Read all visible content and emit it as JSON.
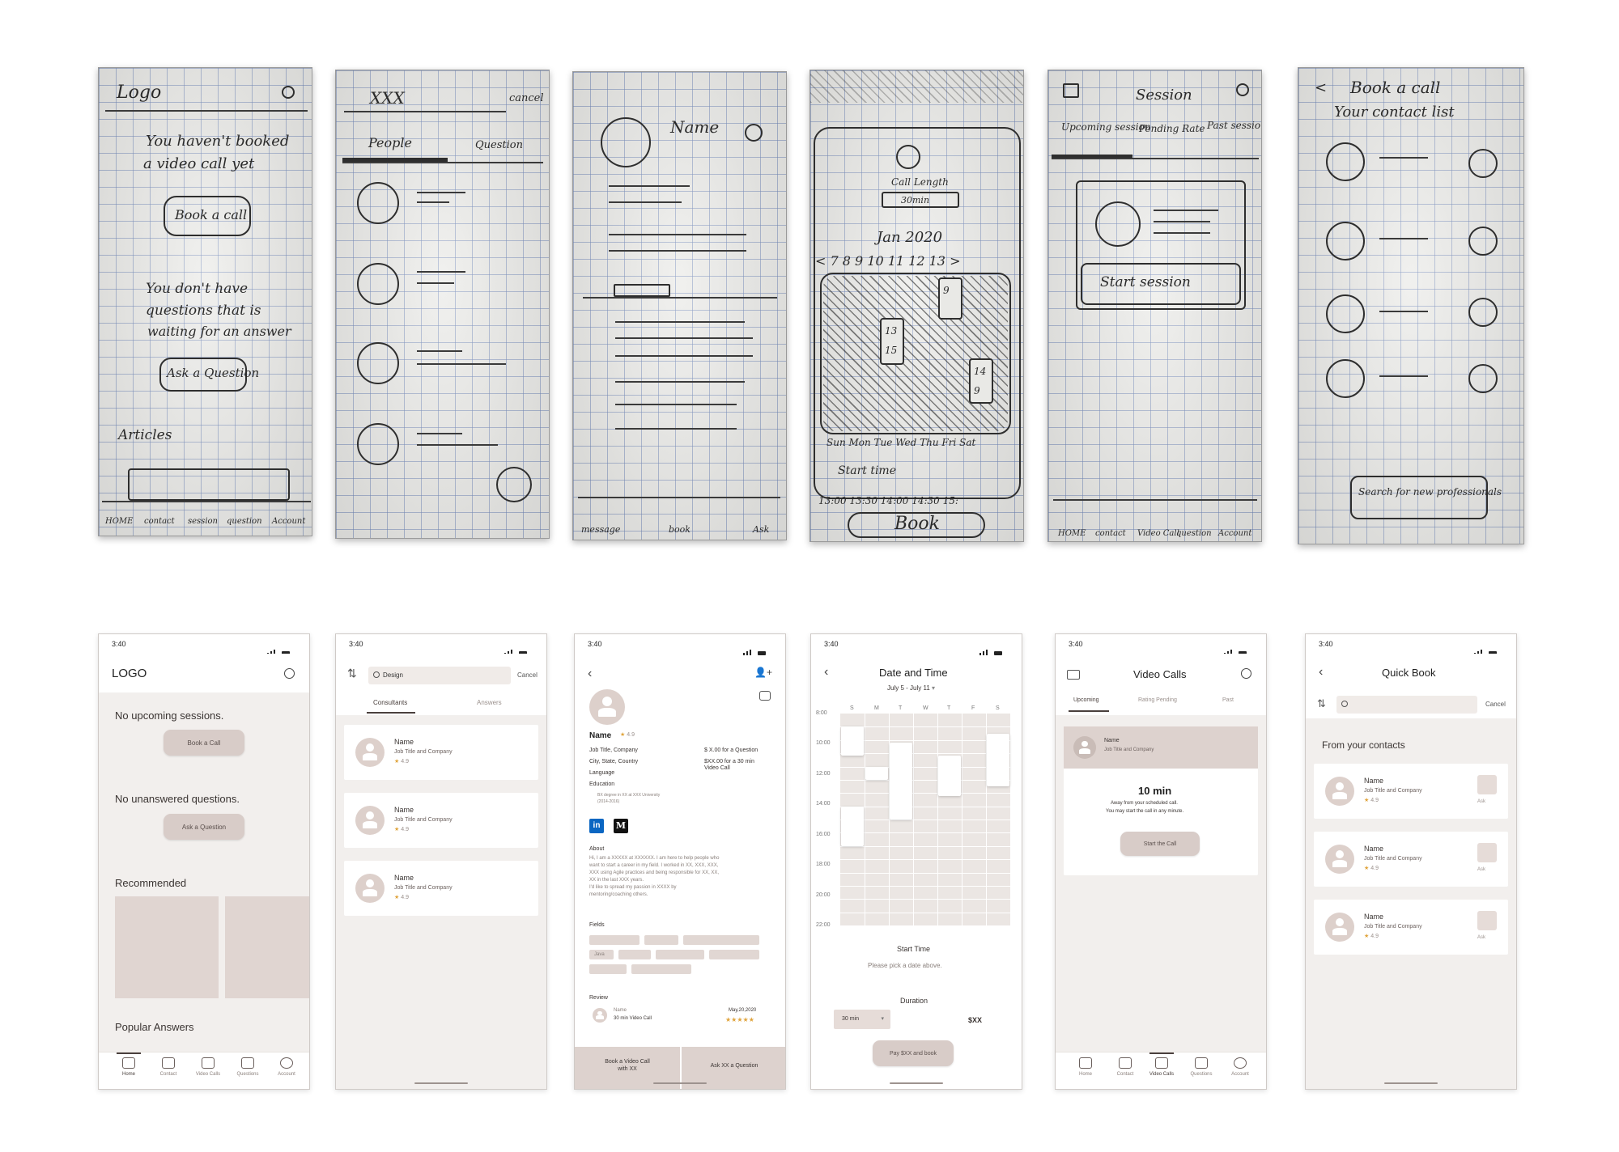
{
  "sketches": {
    "s1": {
      "logo": "Logo",
      "line1": "You haven't booked",
      "line2": "a video call yet",
      "btn1": "Book a call",
      "line3": "You don't have",
      "line4": "questions that is",
      "line5": "waiting for an answer",
      "btn2": "Ask a Question",
      "articles": "Articles",
      "tabs": [
        "HOME",
        "contact",
        "session",
        "question",
        "Account"
      ]
    },
    "s2": {
      "search": "XXX",
      "cancel": "cancel",
      "tab1": "People",
      "tab2": "Question"
    },
    "s3": {
      "name": "Name",
      "bottom": [
        "message",
        "book",
        "Ask"
      ]
    },
    "s4": {
      "call_length": "Call Length",
      "dur": "30min",
      "month": "Jan 2020",
      "days": "< 7  8  9  10  11  12  13 >",
      "weekdays": "Sun Mon Tue Wed Thu Fri Sat",
      "start": "Start time",
      "times": "13:00  13:30  14:00  14:30  15:",
      "book": "Book",
      "slots": [
        "9",
        "13",
        "14",
        "15",
        "14",
        "9"
      ]
    },
    "s5": {
      "title": "Session",
      "tabs": [
        "Upcoming session",
        "Pending Rate",
        "Past session"
      ],
      "start": "Start session",
      "bottom": [
        "HOME",
        "contact",
        "Video Call",
        "question",
        "Account"
      ]
    },
    "s6": {
      "title": "Book a call",
      "subtitle": "Your contact list",
      "search": "Search for new professionals"
    }
  },
  "status_time": "3:40",
  "p1": {
    "logo": "LOGO",
    "no_sessions": "No upcoming sessions.",
    "book_call": "Book a Call",
    "no_questions": "No unanswered questions.",
    "ask": "Ask a Question",
    "recommended": "Recommended",
    "popular": "Popular Answers"
  },
  "tabbar": [
    "Home",
    "Contact",
    "Video Calls",
    "Questions",
    "Account"
  ],
  "p2": {
    "search": "Design",
    "cancel": "Cancel",
    "tabs": [
      "Consultants",
      "Answers"
    ],
    "cards": [
      {
        "name": "Name",
        "job": "Job Title and Company",
        "rating": "4.9"
      },
      {
        "name": "Name",
        "job": "Job Title and Company",
        "rating": "4.9"
      },
      {
        "name": "Name",
        "job": "Job Title and Company",
        "rating": "4.9"
      }
    ]
  },
  "p3": {
    "name": "Name",
    "rating": "4.9",
    "job": "Job Title, Company",
    "city": "City, State, Country",
    "language": "Language",
    "education": "Education",
    "degree": "BX degree in XX at XXX University",
    "years": "(2014-2016)",
    "price_q": "$ X.00 for a Question",
    "price_v1": "$XX.00 for a 30 min",
    "price_v2": "Video Call",
    "about": "About",
    "about_text": [
      "Hi, I am a XXXXX at XXXXXX. I am here to help people who",
      "want to start a career in my field. I worked in XX, XXX, XXX,",
      "XXX using Agile practices and being responsible for XX, XX,",
      "XX in the last XXX years.",
      "I'd like to spread my passion in XXXX by",
      "mentoring/coaching others."
    ],
    "fields": "Fields",
    "field_tag": "Java",
    "review": "Review",
    "reviewer": "Name",
    "review_type": "30 min Video Call",
    "review_date": "May,20,2020",
    "btn_book1": "Book a Video Call",
    "btn_book2": "with XX",
    "btn_ask": "Ask XX a Question"
  },
  "p4": {
    "title": "Date and Time",
    "range": "July 5 - July 11",
    "days": [
      "S",
      "M",
      "T",
      "W",
      "T",
      "F",
      "S"
    ],
    "times": [
      "8:00",
      "10:00",
      "12:00",
      "14:00",
      "16:00",
      "18:00",
      "20:00",
      "22:00"
    ],
    "start_time": "Start Time",
    "pick": "Please pick a date above.",
    "duration": "Duration",
    "dur_value": "30 min",
    "price": "$XX",
    "pay": "Pay $XX and book"
  },
  "p5": {
    "title": "Video Calls",
    "tabs": [
      "Upcoming",
      "Rating Pending",
      "Past"
    ],
    "name": "Name",
    "job": "Job Title and Company",
    "time": "10 min",
    "away": "Away from your scheduled call.",
    "may": "You may start the call in any minute.",
    "start": "Start the Call"
  },
  "p6": {
    "title": "Quick Book",
    "cancel": "Cancel",
    "from": "From your contacts",
    "ask": "Ask",
    "cards": [
      {
        "name": "Name",
        "job": "Job Title and Company",
        "rating": "4.9"
      },
      {
        "name": "Name",
        "job": "Job Title and Company",
        "rating": "4.9"
      },
      {
        "name": "Name",
        "job": "Job Title and Company",
        "rating": "4.9"
      }
    ]
  }
}
